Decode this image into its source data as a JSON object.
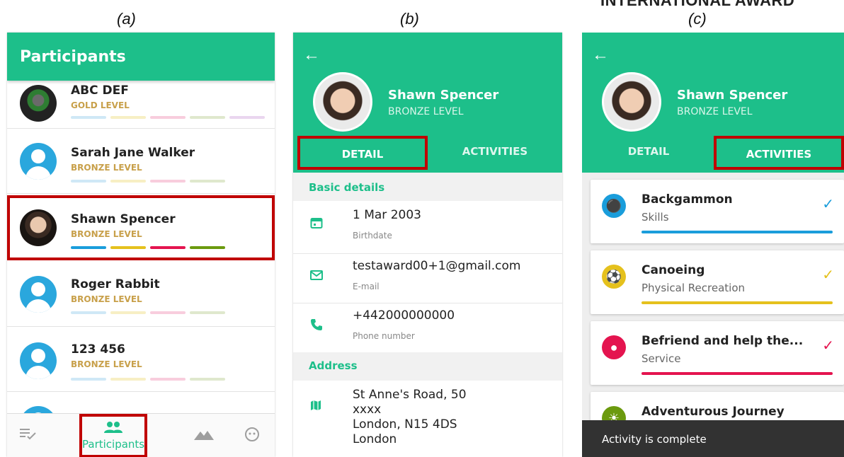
{
  "captions": {
    "a": "(a)",
    "b": "(b)",
    "c": "(c)"
  },
  "corner_brand": "INTERNATIONAL AWARD",
  "colors": {
    "primary": "#1dbf8a",
    "highlight": "#c00000",
    "level": "#c8a04a"
  },
  "panel_a": {
    "title": "Participants",
    "participants": [
      {
        "name": "ABC DEF",
        "level": "GOLD LEVEL",
        "avatar": "photo-green-book",
        "bars": [
          "#cfe8f6",
          "#f7efc4",
          "#f8cddd",
          "#dfe8cd",
          "#ead6ef"
        ]
      },
      {
        "name": "Sarah Jane Walker",
        "level": "BRONZE LEVEL",
        "avatar": "default-avatar",
        "bars": [
          "#cfe8f6",
          "#f7efc4",
          "#f8cddd",
          "#dfe8cd"
        ]
      },
      {
        "name": "Shawn Spencer",
        "level": "BRONZE LEVEL",
        "avatar": "photo",
        "bars": [
          "#1a9ddb",
          "#e5c11d",
          "#e4144f",
          "#6b9a0e"
        ]
      },
      {
        "name": "Roger  Rabbit",
        "level": "BRONZE LEVEL",
        "avatar": "default-avatar",
        "bars": [
          "#cfe8f6",
          "#f7efc4",
          "#f8cddd",
          "#dfe8cd"
        ]
      },
      {
        "name": "123 456",
        "level": "BRONZE LEVEL",
        "avatar": "default-avatar",
        "bars": [
          "#cfe8f6",
          "#f7efc4",
          "#f8cddd",
          "#dfe8cd"
        ]
      }
    ],
    "nav": {
      "tasks_icon": "checklist-icon",
      "participants_label": "Participants",
      "mountains_icon": "mountains-icon",
      "profile_icon": "face-icon"
    }
  },
  "profile": {
    "back_icon": "back-arrow-icon",
    "name": "Shawn Spencer",
    "level": "BRONZE LEVEL",
    "tab_detail": "DETAIL",
    "tab_activities": "ACTIVITIES"
  },
  "panel_b": {
    "section_basic": "Basic details",
    "birthdate": {
      "value": "1 Mar 2003",
      "label": "Birthdate",
      "icon": "calendar-icon"
    },
    "email": {
      "value": "testaward00+1@gmail.com",
      "label": "E-mail",
      "icon": "mail-icon"
    },
    "phone": {
      "value": "+442000000000",
      "label": "Phone number",
      "icon": "phone-icon"
    },
    "section_address": "Address",
    "address": {
      "value": "St Anne's Road, 50\nxxxx\nLondon, N15 4DS\nLondon",
      "icon": "map-icon"
    }
  },
  "panel_c": {
    "activities": [
      {
        "title": "Backgammon",
        "category": "Skills",
        "color": "#1a9ddb",
        "icon": "skills-icon"
      },
      {
        "title": "Canoeing",
        "category": "Physical Recreation",
        "color": "#e5c11d",
        "icon": "recreation-icon"
      },
      {
        "title": "Befriend and help the...",
        "category": "Service",
        "color": "#e4144f",
        "icon": "handshake-icon"
      },
      {
        "title": "Adventurous Journey",
        "category": "",
        "color": "#6b9a0e",
        "icon": "journey-icon"
      }
    ],
    "snackbar": "Activity is complete"
  }
}
